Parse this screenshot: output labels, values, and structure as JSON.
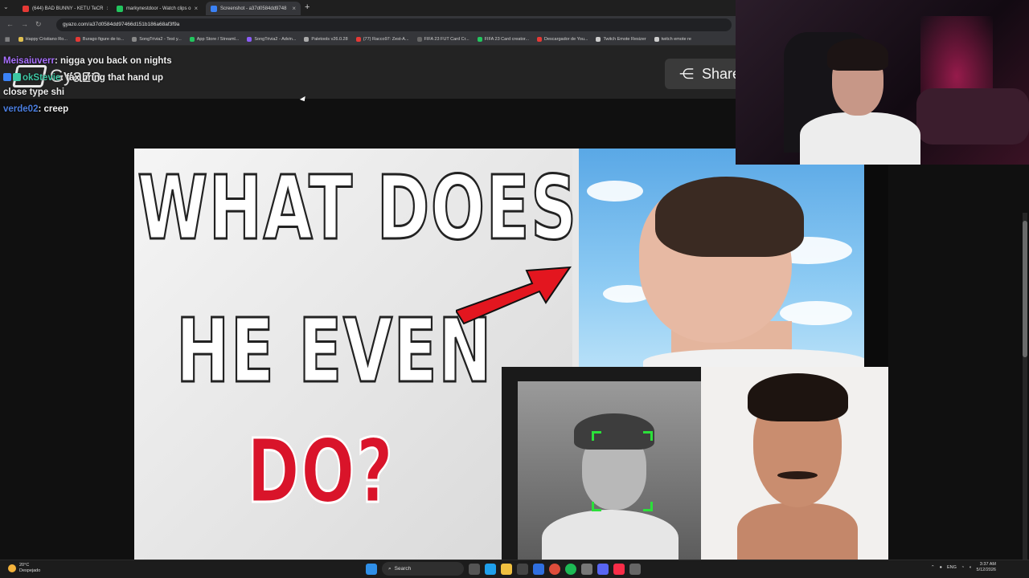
{
  "browser": {
    "tabs": [
      {
        "label": "(644) BAD BUNNY - KETU TeCR",
        "active": false,
        "color": "#e53935"
      },
      {
        "label": "markynestdoor - Watch clips o",
        "active": false,
        "color": "#22c55e"
      },
      {
        "label": "Screenshot - a37d0584dd9748",
        "active": true,
        "color": "#3b82f6"
      }
    ],
    "url": "gyazo.com/a37d0584dd97466d151b186a68af3f9a",
    "bookmarks": [
      {
        "label": "Happy Cristiano Ro...",
        "color": "#e0c050"
      },
      {
        "label": "Burago figure de to...",
        "color": "#e53935"
      },
      {
        "label": "SongTrivia2 - Test y...",
        "color": "#888888"
      },
      {
        "label": "App Store / Streaml...",
        "color": "#22c55e"
      },
      {
        "label": "SongTrivia2 - Advin...",
        "color": "#8b5cf6"
      },
      {
        "label": "Paletools v26.0.28",
        "color": "#aaaaaa"
      },
      {
        "label": "(77) Racco97: Zest-A...",
        "color": "#e53935"
      },
      {
        "label": "FIFA 23 FUT Card Cr...",
        "color": "#666666"
      },
      {
        "label": "FIFA 23 Card creator...",
        "color": "#22c55e"
      },
      {
        "label": "Descargador de You...",
        "color": "#e53935"
      },
      {
        "label": "Twitch Emote Resizer",
        "color": "#cccccc"
      },
      {
        "label": "twitch emote re",
        "color": "#cccccc"
      }
    ]
  },
  "gyazo": {
    "logo_text": "Gyazo",
    "share_label": "Share"
  },
  "chat": [
    {
      "user": "Meisaiuverr",
      "message": ": nigga you back on nights",
      "color": "#a970ff"
    },
    {
      "user": "okStevie",
      "message": ": fax bring that hand up close type shi",
      "color": "#3ec7a4"
    },
    {
      "user": "verde02",
      "message": ": creep",
      "color": "#4a7dde"
    }
  ],
  "thumbnail": {
    "line1": "WHAT DOES",
    "line2": "HE EVEN",
    "line3": "DO?"
  },
  "taskbar": {
    "temp": "20°C",
    "weather": "Despejado",
    "search_label": "Search",
    "lang": "ENG",
    "time": "3:37 AM",
    "date": "5/12/2026"
  }
}
